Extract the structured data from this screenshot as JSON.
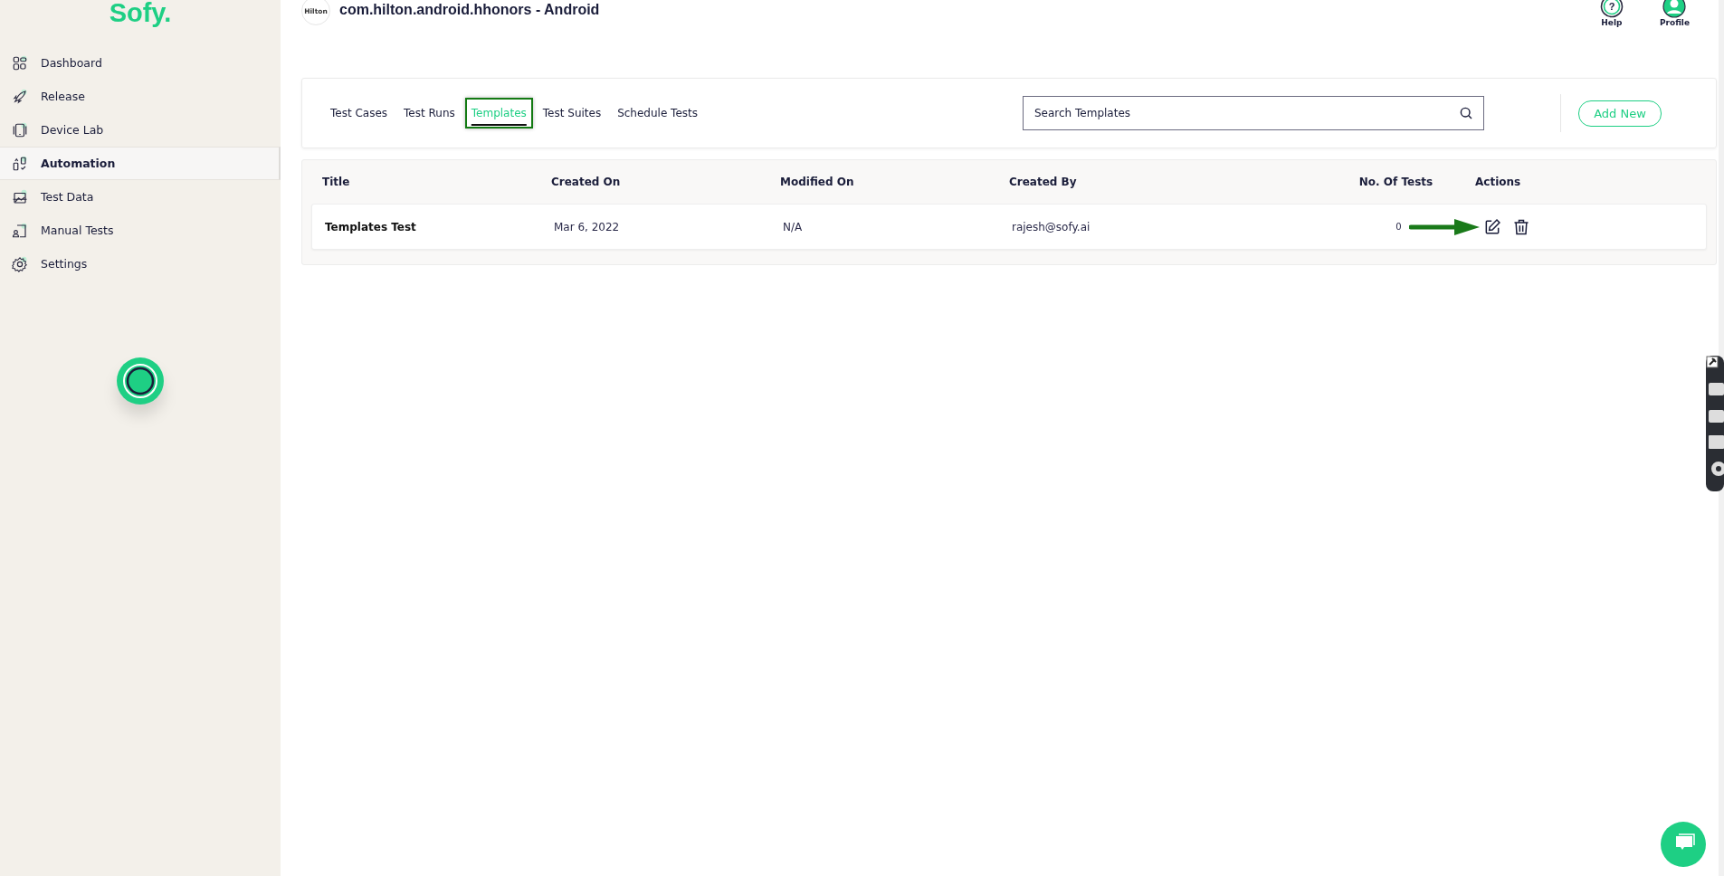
{
  "sidebar": {
    "logo": "Sofy.",
    "items": [
      {
        "label": "Dashboard",
        "selected": false
      },
      {
        "label": "Release",
        "selected": false
      },
      {
        "label": "Device Lab",
        "selected": false
      },
      {
        "label": "Automation",
        "selected": true
      },
      {
        "label": "Test Data",
        "selected": false
      },
      {
        "label": "Manual Tests",
        "selected": false
      },
      {
        "label": "Settings",
        "selected": false
      }
    ]
  },
  "header": {
    "app_logo": "Hilton",
    "title": "com.hilton.android.hhonors - Android",
    "actions": [
      {
        "label": "Help",
        "kind": "help",
        "glyph": "?"
      },
      {
        "label": "Profile",
        "kind": "profile"
      }
    ]
  },
  "tabs": [
    {
      "label": "Test Cases",
      "selected": false
    },
    {
      "label": "Test Runs",
      "selected": false
    },
    {
      "label": "Templates",
      "selected": true
    },
    {
      "label": "Test Suites",
      "selected": false
    },
    {
      "label": "Schedule Tests",
      "selected": false
    }
  ],
  "search": {
    "placeholder": "Search Templates"
  },
  "add_button": "Add New",
  "table": {
    "columns": [
      "Title",
      "Created On",
      "Modified On",
      "Created By",
      "No. Of Tests",
      "Actions"
    ],
    "rows": [
      {
        "title": "Templates Test",
        "created_on": "Mar 6, 2022",
        "modified_on": "N/A",
        "created_by": "rajesh@sofy.ai",
        "tests": "0"
      }
    ]
  }
}
